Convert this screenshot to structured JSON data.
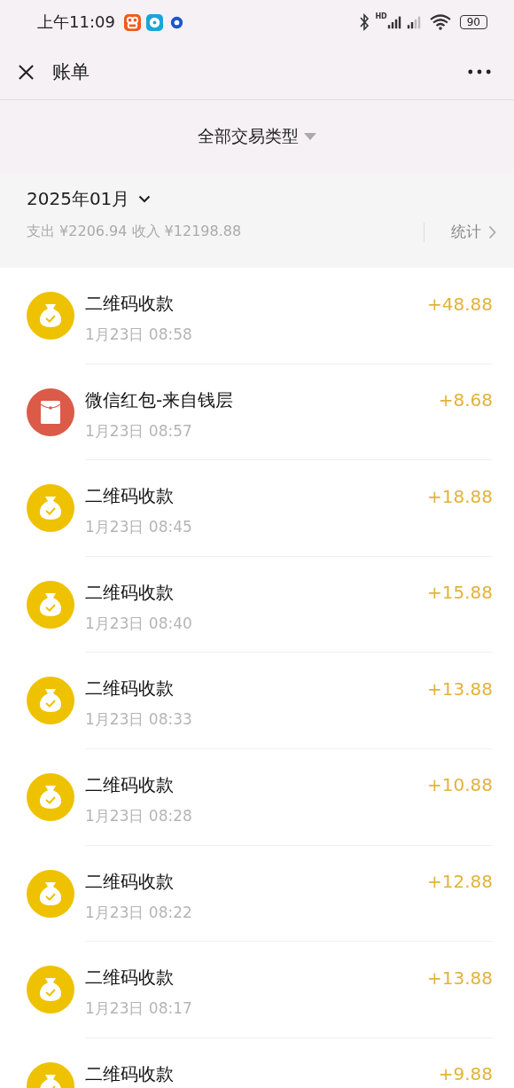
{
  "status_bar": {
    "time": "上午11:09",
    "network_label": "HD",
    "battery": "90"
  },
  "nav": {
    "title": "账单"
  },
  "filter": {
    "label": "全部交易类型"
  },
  "summary": {
    "month": "2025年01月",
    "totals": "支出 ¥2206.94 收入 ¥12198.88",
    "stats_link": "统计"
  },
  "transactions": [
    {
      "kind": "qr",
      "title": "二维码收款",
      "time": "1月23日 08:58",
      "amount": "+48.88"
    },
    {
      "kind": "red_packet",
      "title": "微信红包-来自钱层",
      "time": "1月23日 08:57",
      "amount": "+8.68"
    },
    {
      "kind": "qr",
      "title": "二维码收款",
      "time": "1月23日 08:45",
      "amount": "+18.88"
    },
    {
      "kind": "qr",
      "title": "二维码收款",
      "time": "1月23日 08:40",
      "amount": "+15.88"
    },
    {
      "kind": "qr",
      "title": "二维码收款",
      "time": "1月23日 08:33",
      "amount": "+13.88"
    },
    {
      "kind": "qr",
      "title": "二维码收款",
      "time": "1月23日 08:28",
      "amount": "+10.88"
    },
    {
      "kind": "qr",
      "title": "二维码收款",
      "time": "1月23日 08:22",
      "amount": "+12.88"
    },
    {
      "kind": "qr",
      "title": "二维码收款",
      "time": "1月23日 08:17",
      "amount": "+13.88"
    },
    {
      "kind": "qr",
      "title": "二维码收款",
      "amount": "+9.88"
    }
  ]
}
